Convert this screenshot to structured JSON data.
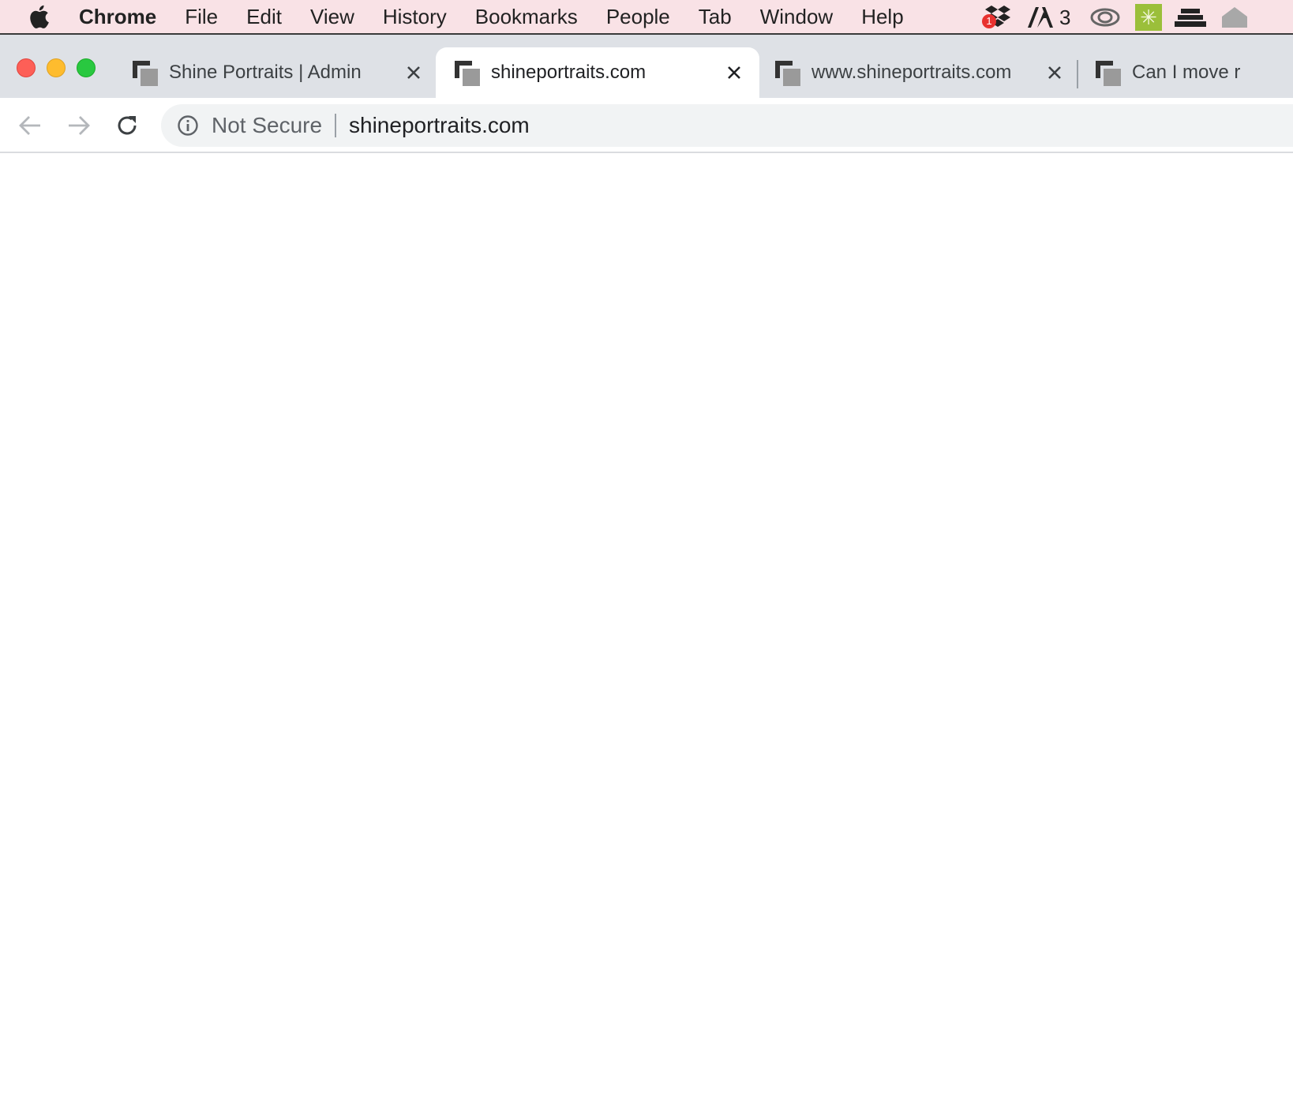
{
  "menubar": {
    "app_name": "Chrome",
    "items": [
      "File",
      "Edit",
      "View",
      "History",
      "Bookmarks",
      "People",
      "Tab",
      "Window",
      "Help"
    ],
    "tray": {
      "dropbox_badge": "1",
      "adobe_count": "3"
    },
    "background_color": "#f9e2e6"
  },
  "tabs": [
    {
      "title": "Shine Portraits | Admin",
      "active": false
    },
    {
      "title": "shineportraits.com",
      "active": true
    },
    {
      "title": "www.shineportraits.com",
      "active": false
    },
    {
      "title": "Can I move r",
      "active": false
    }
  ],
  "omnibox": {
    "security_label": "Not Secure",
    "url": "shineportraits.com"
  },
  "icons": {
    "apple": "apple-icon",
    "favicon": "generic-favicon-icon",
    "close": "close-icon",
    "back": "back-arrow-icon",
    "forward": "forward-arrow-icon",
    "reload": "reload-icon",
    "info": "info-icon"
  }
}
